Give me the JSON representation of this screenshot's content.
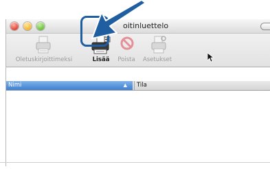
{
  "window": {
    "title": "oitinluettelo"
  },
  "toolbar": {
    "default_printer_label": "Oletuskirjoittimeksi",
    "add_label": "Lisää",
    "remove_label": "Poista",
    "settings_label": "Asetukset"
  },
  "table": {
    "columns": [
      "Nimi",
      "Tila"
    ]
  },
  "colors": {
    "highlight_ring": "#1f5ea0",
    "selected_column": "#3d7fd1"
  },
  "icons": [
    "printer-icon",
    "printer-add-icon",
    "delete-icon",
    "printer-settings-icon",
    "arrow-pointer-icon",
    "mouse-cursor-icon"
  ]
}
